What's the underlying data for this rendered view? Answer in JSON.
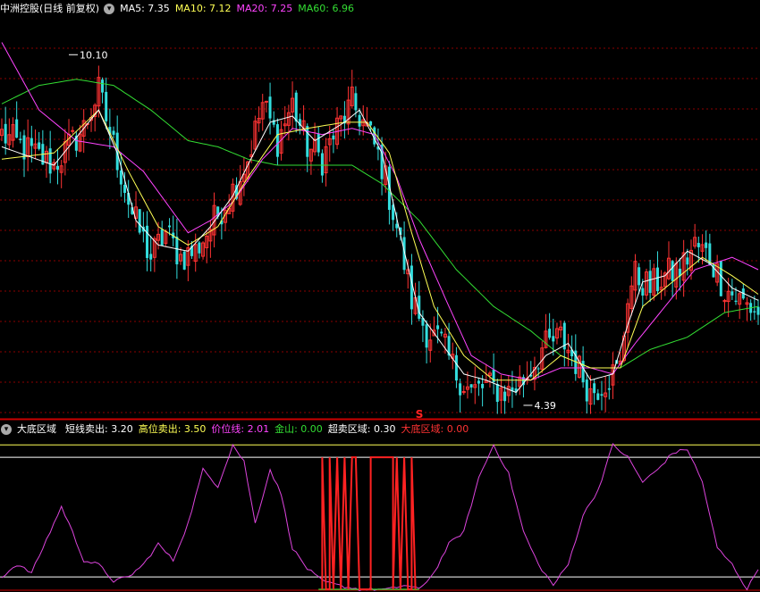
{
  "main": {
    "title": "中洲控股(日线 前复权)",
    "indicators": [
      {
        "label": "MA5: ",
        "value": "7.35",
        "color": "#ffffff"
      },
      {
        "label": "MA10: ",
        "value": "7.12",
        "color": "#ffff55"
      },
      {
        "label": "MA20: ",
        "value": "7.25",
        "color": "#ff44ff"
      },
      {
        "label": "MA60: ",
        "value": "6.96",
        "color": "#33dd33"
      }
    ],
    "high_label": "10.10",
    "low_label": "4.39",
    "signal_mark": "S"
  },
  "sub": {
    "title": "大底区域",
    "indicators": [
      {
        "label": "短线卖出: ",
        "value": "3.20",
        "color": "#ffffff"
      },
      {
        "label": "高位卖出: ",
        "value": "3.50",
        "color": "#ffff55"
      },
      {
        "label": "价位线: ",
        "value": "2.01",
        "color": "#ff44ff"
      },
      {
        "label": "金山: ",
        "value": "0.00",
        "color": "#33dd33"
      },
      {
        "label": "超卖区域: ",
        "value": "0.30",
        "color": "#ffffff"
      },
      {
        "label": "大底区域: ",
        "value": "0.00",
        "color": "#ff3333"
      }
    ]
  },
  "colors": {
    "up": "#ff3333",
    "down": "#33dddd",
    "ma5": "#ffffff",
    "ma10": "#ffff55",
    "ma20": "#ff44ff",
    "ma60": "#33dd33",
    "grid": "#8b0000",
    "axis": "#cc0000",
    "price_line": "#dd44dd",
    "signal": "#ff2222"
  },
  "chart_data": [
    {
      "type": "candlestick",
      "ylim": [
        4.2,
        10.7
      ],
      "price_waypoints": [
        [
          0,
          8.8
        ],
        [
          8,
          8.5
        ],
        [
          14,
          8.3
        ],
        [
          22,
          8.9
        ],
        [
          26,
          9.5
        ],
        [
          31,
          8.4
        ],
        [
          35,
          7.5
        ],
        [
          40,
          6.8
        ],
        [
          44,
          7.2
        ],
        [
          48,
          6.8
        ],
        [
          52,
          6.9
        ],
        [
          56,
          7.3
        ],
        [
          62,
          7.9
        ],
        [
          66,
          8.4
        ],
        [
          70,
          9.3
        ],
        [
          74,
          8.7
        ],
        [
          78,
          9.3
        ],
        [
          82,
          8.6
        ],
        [
          86,
          8.4
        ],
        [
          90,
          8.9
        ],
        [
          94,
          9.3
        ],
        [
          98,
          8.9
        ],
        [
          102,
          8.3
        ],
        [
          106,
          7.3
        ],
        [
          110,
          6.1
        ],
        [
          114,
          5.6
        ],
        [
          118,
          5.4
        ],
        [
          122,
          4.9
        ],
        [
          126,
          4.6
        ],
        [
          130,
          4.7
        ],
        [
          136,
          4.6
        ],
        [
          140,
          4.8
        ],
        [
          145,
          5.3
        ],
        [
          150,
          5.5
        ],
        [
          154,
          5.1
        ],
        [
          158,
          4.6
        ],
        [
          162,
          4.8
        ],
        [
          166,
          5.0
        ],
        [
          168,
          6.2
        ],
        [
          170,
          6.5
        ],
        [
          174,
          6.3
        ],
        [
          178,
          6.5
        ],
        [
          182,
          6.6
        ],
        [
          186,
          7.0
        ],
        [
          190,
          6.8
        ],
        [
          194,
          6.3
        ],
        [
          198,
          6.1
        ],
        [
          203,
          5.9
        ]
      ],
      "ma5_waypoints": [
        [
          0,
          8.6
        ],
        [
          14,
          8.3
        ],
        [
          22,
          8.9
        ],
        [
          26,
          9.2
        ],
        [
          31,
          8.5
        ],
        [
          36,
          7.4
        ],
        [
          42,
          7.0
        ],
        [
          50,
          6.9
        ],
        [
          56,
          7.3
        ],
        [
          62,
          7.8
        ],
        [
          66,
          8.3
        ],
        [
          72,
          9.0
        ],
        [
          78,
          9.1
        ],
        [
          84,
          8.7
        ],
        [
          92,
          9.0
        ],
        [
          96,
          9.2
        ],
        [
          102,
          8.5
        ],
        [
          108,
          6.9
        ],
        [
          112,
          5.9
        ],
        [
          118,
          5.4
        ],
        [
          124,
          4.9
        ],
        [
          130,
          4.8
        ],
        [
          138,
          4.6
        ],
        [
          146,
          5.2
        ],
        [
          152,
          5.4
        ],
        [
          158,
          4.8
        ],
        [
          164,
          4.9
        ],
        [
          168,
          5.7
        ],
        [
          172,
          6.4
        ],
        [
          178,
          6.5
        ],
        [
          184,
          6.9
        ],
        [
          190,
          6.7
        ],
        [
          196,
          6.3
        ],
        [
          203,
          6.1
        ]
      ],
      "ma10_waypoints": [
        [
          0,
          8.4
        ],
        [
          14,
          8.5
        ],
        [
          26,
          9.2
        ],
        [
          34,
          8.2
        ],
        [
          42,
          7.3
        ],
        [
          50,
          7.0
        ],
        [
          58,
          7.3
        ],
        [
          66,
          8.1
        ],
        [
          74,
          8.8
        ],
        [
          82,
          8.9
        ],
        [
          92,
          9.0
        ],
        [
          98,
          9.0
        ],
        [
          104,
          8.5
        ],
        [
          110,
          7.2
        ],
        [
          116,
          6.0
        ],
        [
          124,
          5.2
        ],
        [
          132,
          4.8
        ],
        [
          142,
          4.8
        ],
        [
          150,
          5.2
        ],
        [
          158,
          5.0
        ],
        [
          166,
          5.0
        ],
        [
          172,
          6.0
        ],
        [
          180,
          6.4
        ],
        [
          188,
          6.8
        ],
        [
          196,
          6.5
        ],
        [
          203,
          6.2
        ]
      ],
      "ma20_waypoints": [
        [
          0,
          10.3
        ],
        [
          10,
          9.2
        ],
        [
          20,
          8.7
        ],
        [
          30,
          8.6
        ],
        [
          38,
          8.2
        ],
        [
          44,
          7.7
        ],
        [
          50,
          7.2
        ],
        [
          56,
          7.4
        ],
        [
          62,
          7.7
        ],
        [
          70,
          8.4
        ],
        [
          78,
          8.9
        ],
        [
          86,
          8.8
        ],
        [
          94,
          8.9
        ],
        [
          100,
          8.8
        ],
        [
          106,
          8.1
        ],
        [
          112,
          7.1
        ],
        [
          120,
          6.0
        ],
        [
          126,
          5.2
        ],
        [
          134,
          4.9
        ],
        [
          142,
          4.8
        ],
        [
          150,
          5.0
        ],
        [
          158,
          5.0
        ],
        [
          164,
          4.9
        ],
        [
          170,
          5.4
        ],
        [
          178,
          6.0
        ],
        [
          186,
          6.6
        ],
        [
          196,
          6.8
        ],
        [
          203,
          6.6
        ]
      ],
      "ma60_waypoints": [
        [
          0,
          9.3
        ],
        [
          10,
          9.6
        ],
        [
          20,
          9.7
        ],
        [
          30,
          9.6
        ],
        [
          40,
          9.2
        ],
        [
          50,
          8.7
        ],
        [
          58,
          8.6
        ],
        [
          66,
          8.4
        ],
        [
          74,
          8.3
        ],
        [
          84,
          8.3
        ],
        [
          94,
          8.3
        ],
        [
          102,
          8.0
        ],
        [
          112,
          7.4
        ],
        [
          122,
          6.6
        ],
        [
          132,
          6.0
        ],
        [
          142,
          5.6
        ],
        [
          150,
          5.2
        ],
        [
          158,
          5.0
        ],
        [
          166,
          5.0
        ],
        [
          174,
          5.3
        ],
        [
          184,
          5.5
        ],
        [
          194,
          5.9
        ],
        [
          203,
          6.0
        ]
      ],
      "high": 10.1,
      "low": 4.39
    },
    {
      "type": "line",
      "ylim": [
        0,
        3.7
      ],
      "levels": {
        "short_sell": 3.2,
        "high_sell": 3.5,
        "oversold": 0.3,
        "bottom": 0.0
      },
      "price_line_waypoints": [
        [
          0,
          0.3
        ],
        [
          4,
          0.6
        ],
        [
          8,
          0.4
        ],
        [
          12,
          1.2
        ],
        [
          16,
          2.0
        ],
        [
          18,
          1.6
        ],
        [
          22,
          0.7
        ],
        [
          26,
          0.6
        ],
        [
          30,
          0.2
        ],
        [
          34,
          0.3
        ],
        [
          38,
          0.6
        ],
        [
          42,
          1.1
        ],
        [
          46,
          0.7
        ],
        [
          50,
          1.6
        ],
        [
          54,
          2.9
        ],
        [
          58,
          2.5
        ],
        [
          62,
          3.5
        ],
        [
          65,
          3.1
        ],
        [
          68,
          1.6
        ],
        [
          72,
          2.9
        ],
        [
          75,
          2.3
        ],
        [
          78,
          1.0
        ],
        [
          82,
          0.5
        ],
        [
          86,
          0.2
        ],
        [
          90,
          0.1
        ],
        [
          96,
          0.0
        ],
        [
          104,
          0.0
        ],
        [
          108,
          0.1
        ],
        [
          112,
          0.0
        ],
        [
          116,
          0.4
        ],
        [
          120,
          1.1
        ],
        [
          124,
          1.4
        ],
        [
          128,
          2.7
        ],
        [
          132,
          3.5
        ],
        [
          136,
          2.8
        ],
        [
          140,
          1.4
        ],
        [
          144,
          0.6
        ],
        [
          148,
          0.1
        ],
        [
          152,
          0.6
        ],
        [
          156,
          1.8
        ],
        [
          160,
          2.4
        ],
        [
          164,
          3.5
        ],
        [
          168,
          3.2
        ],
        [
          172,
          2.6
        ],
        [
          176,
          2.9
        ],
        [
          180,
          3.3
        ],
        [
          184,
          3.4
        ],
        [
          188,
          2.6
        ],
        [
          192,
          1.0
        ],
        [
          196,
          0.6
        ],
        [
          200,
          0.0
        ],
        [
          203,
          0.5
        ]
      ],
      "bottom_signal": [
        [
          86,
          0.0
        ],
        [
          86,
          3.2
        ],
        [
          87,
          0.0
        ],
        [
          88,
          0.0
        ],
        [
          88,
          3.2
        ],
        [
          89,
          0.0
        ],
        [
          90,
          3.2
        ],
        [
          91,
          0.0
        ],
        [
          92,
          3.2
        ],
        [
          93,
          0.0
        ],
        [
          94,
          3.2
        ],
        [
          95,
          3.2
        ],
        [
          96,
          0.0
        ],
        [
          99,
          0.0
        ],
        [
          99,
          3.2
        ],
        [
          105,
          3.2
        ],
        [
          105,
          0.0
        ],
        [
          106,
          3.2
        ],
        [
          107,
          0.0
        ],
        [
          108,
          3.2
        ],
        [
          109,
          0.0
        ],
        [
          110,
          0.0
        ],
        [
          110,
          3.2
        ],
        [
          111,
          0.0
        ]
      ]
    }
  ]
}
